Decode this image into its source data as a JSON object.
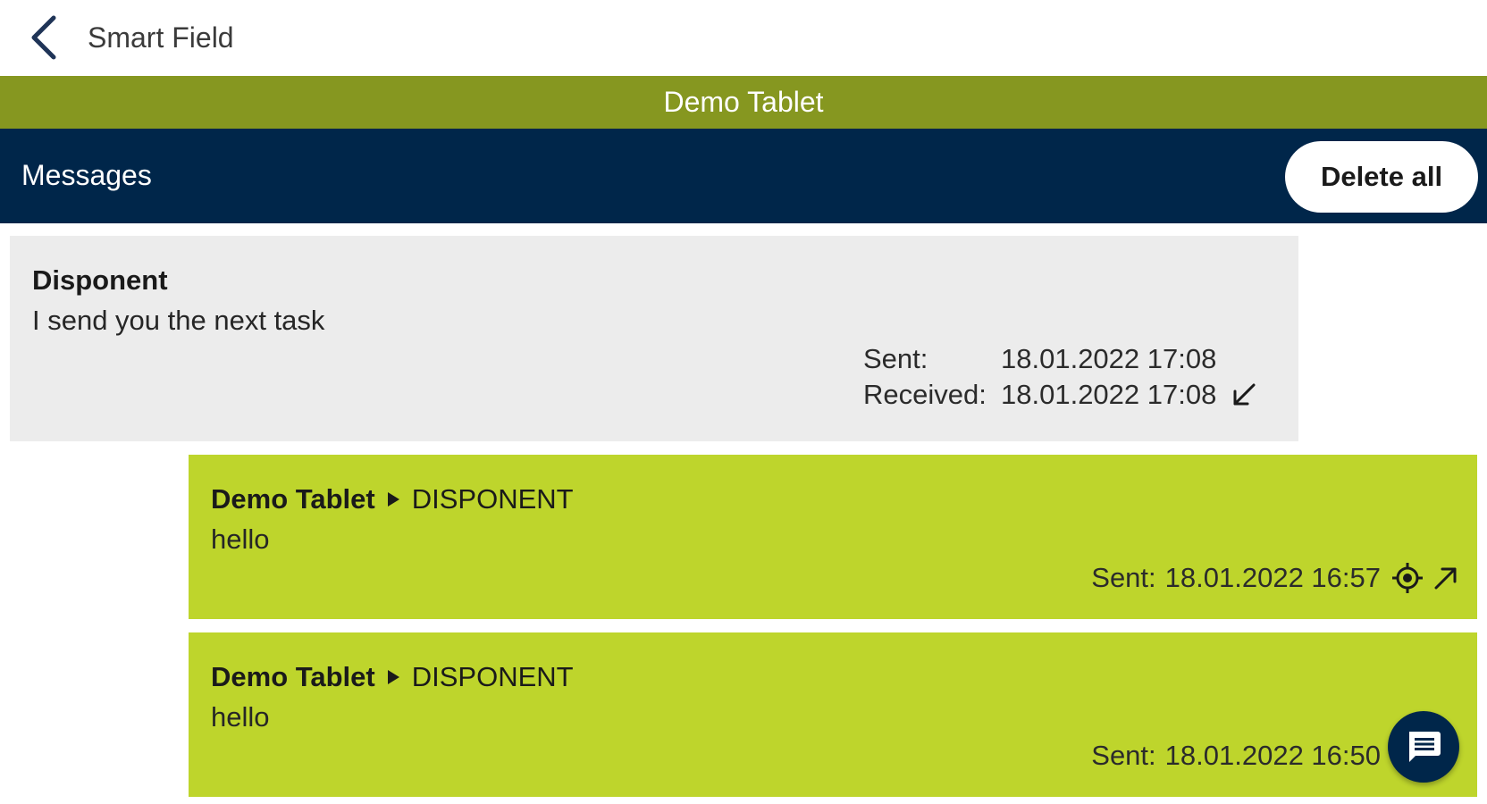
{
  "appbar": {
    "title": "Smart Field"
  },
  "device": {
    "name": "Demo Tablet"
  },
  "messages_header": {
    "title": "Messages",
    "delete_all_label": "Delete all"
  },
  "messages": [
    {
      "direction": "incoming",
      "sender": "Disponent",
      "text": "I send you the next task",
      "sent_label": "Sent:",
      "sent_time": "18.01.2022 17:08",
      "received_label": "Received:",
      "received_time": "18.01.2022 17:08"
    },
    {
      "direction": "outgoing",
      "sender": "Demo Tablet",
      "recipient": "DISPONENT",
      "text": "hello",
      "sent_label": "Sent:",
      "sent_time": "18.01.2022 16:57"
    },
    {
      "direction": "outgoing",
      "sender": "Demo Tablet",
      "recipient": "DISPONENT",
      "text": "hello",
      "sent_label": "Sent:",
      "sent_time": "18.01.2022 16:50"
    }
  ],
  "icons": {
    "back": "chevron-left-icon",
    "received": "arrow-down-left-icon",
    "location": "location-target-icon",
    "sent": "arrow-up-right-icon",
    "compose": "chat-message-icon"
  },
  "colors": {
    "device_bar": "#869720",
    "messages_bar": "#00264a",
    "incoming_bg": "#ececec",
    "outgoing_bg": "#bed52c"
  }
}
